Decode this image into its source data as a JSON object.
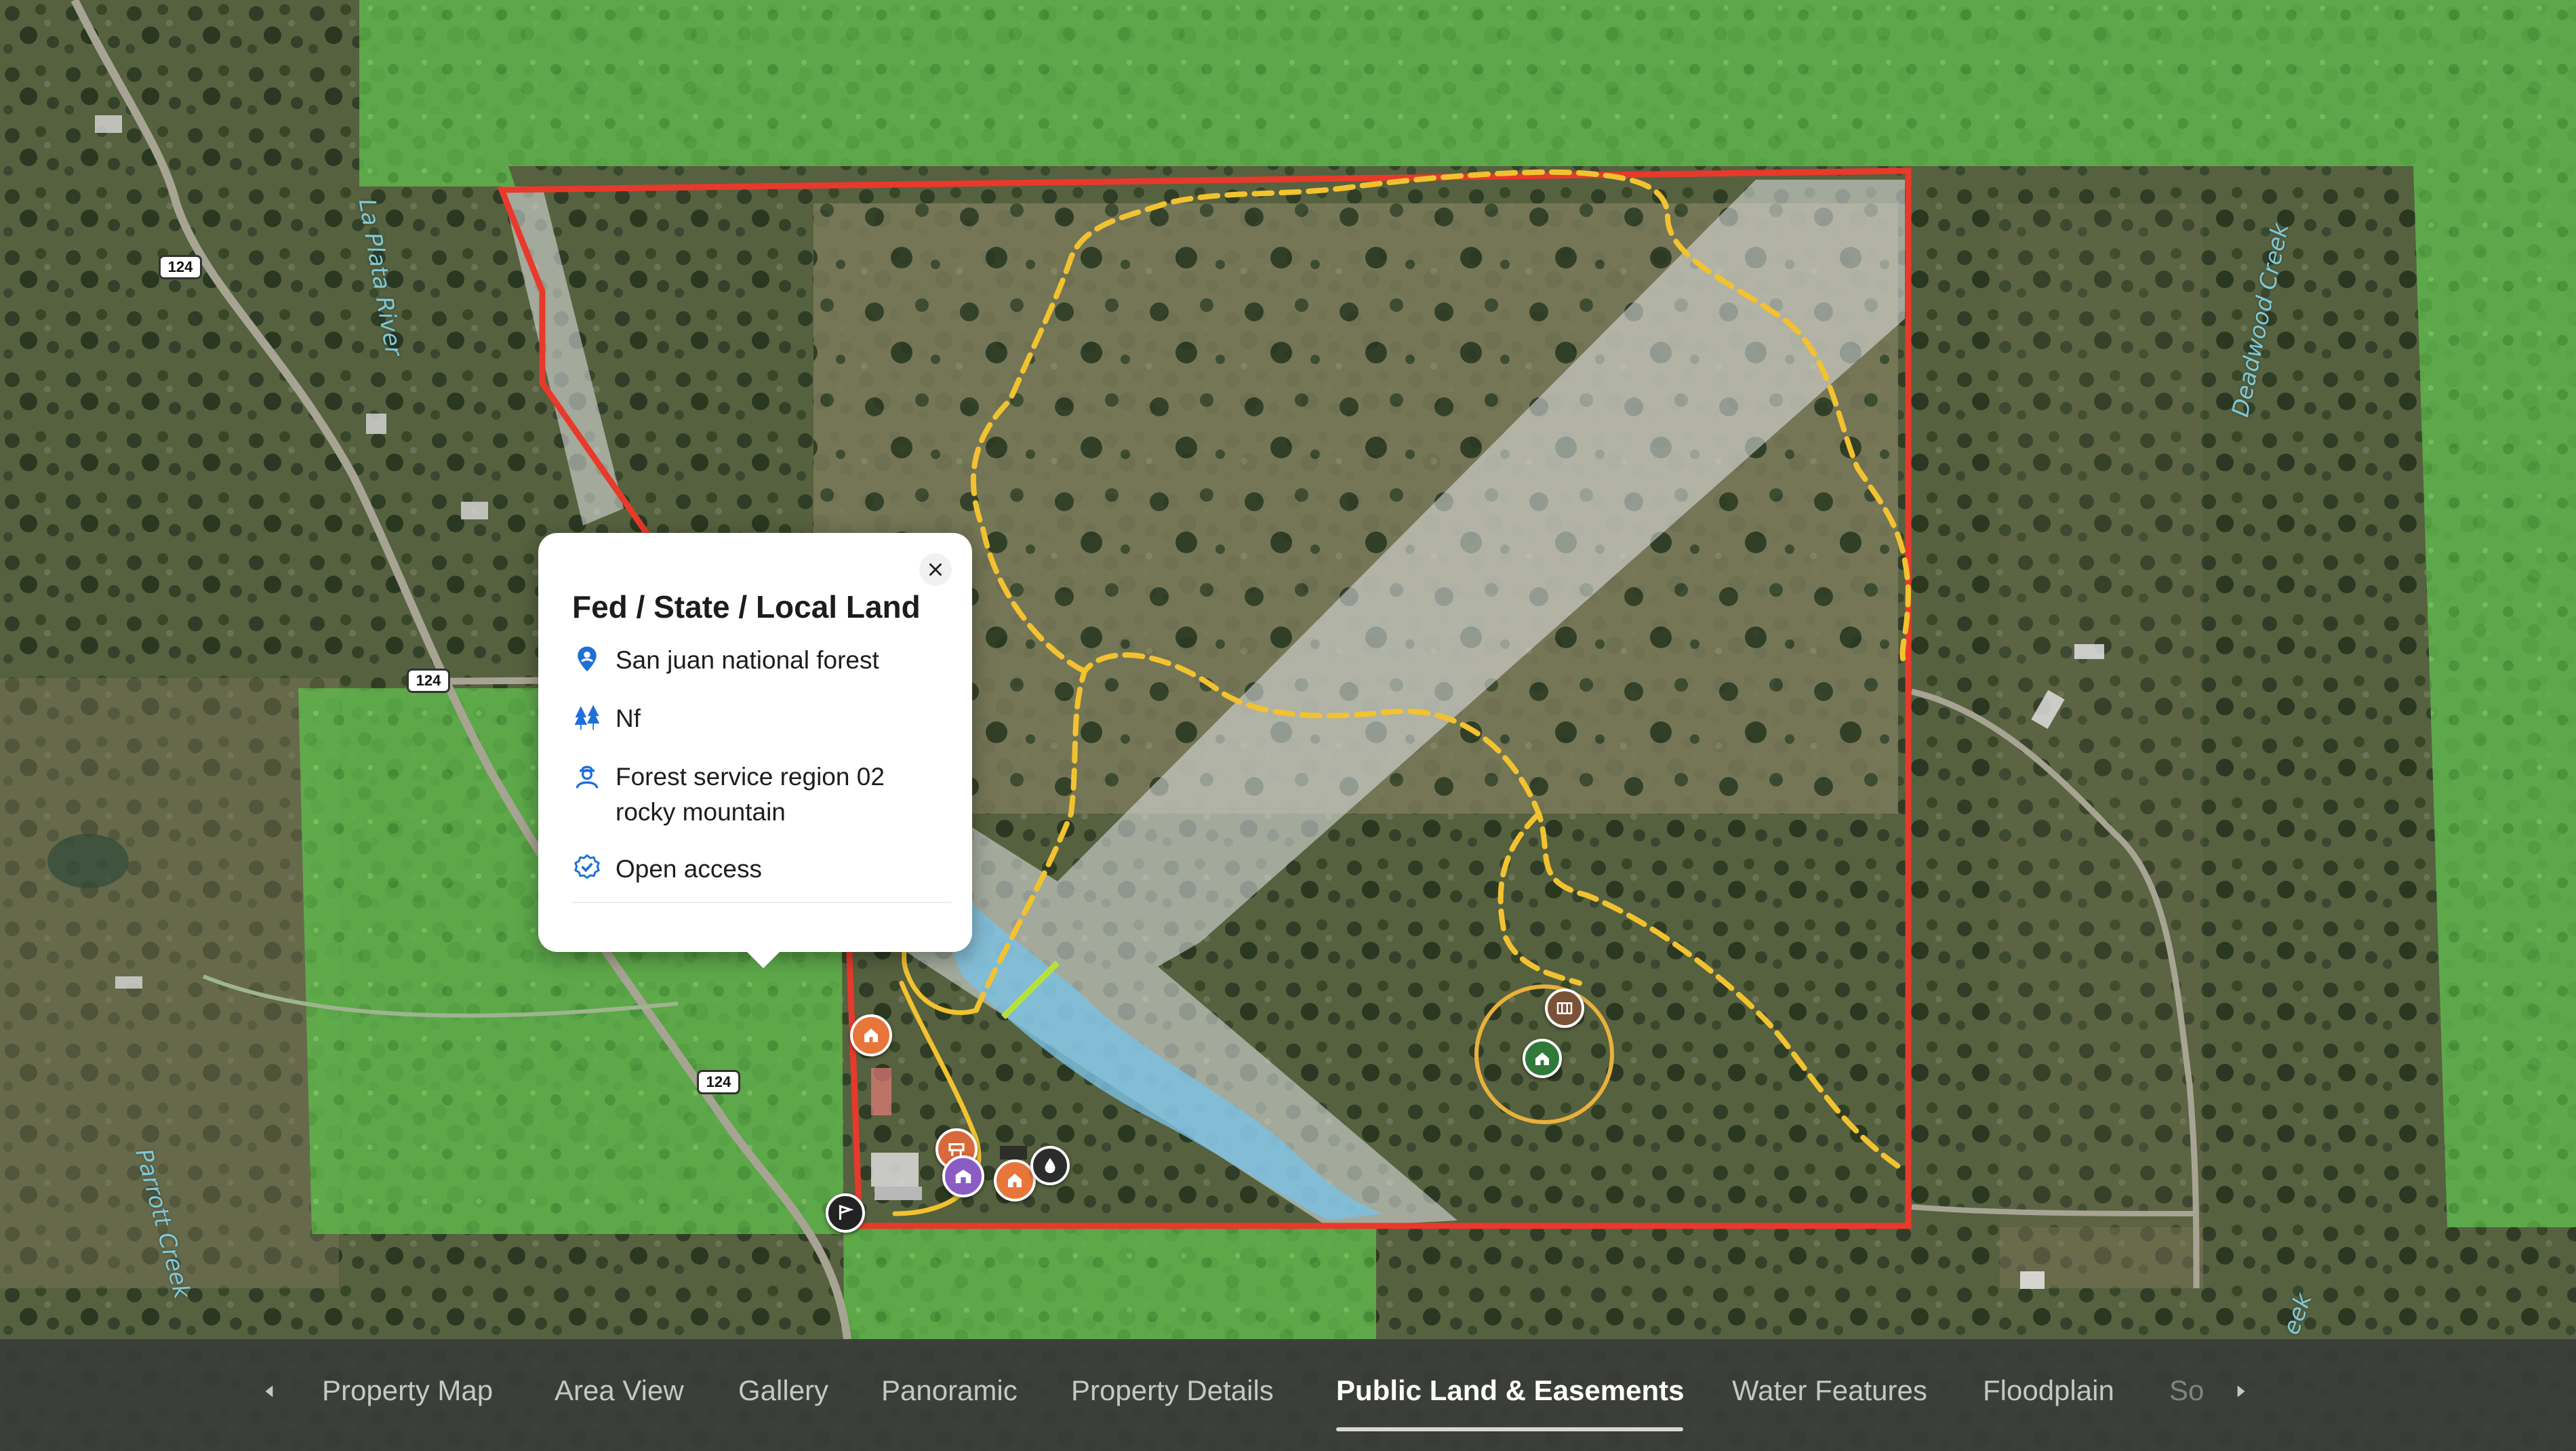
{
  "popup": {
    "title": "Fed / State / Local Land",
    "rows": [
      {
        "icon": "location-person-icon",
        "text": "San juan national forest"
      },
      {
        "icon": "trees-icon",
        "text": "Nf"
      },
      {
        "icon": "ranger-icon",
        "text": "Forest service region 02 rocky mountain"
      },
      {
        "icon": "check-badge-icon",
        "text": "Open access"
      }
    ]
  },
  "map_labels": {
    "la_plata_river": "La Plata River",
    "deadwood_creek": "Deadwood Creek",
    "parrott_creek": "Parrott Creek",
    "creek_bottom_right": "eek",
    "highway": "124"
  },
  "tabs": {
    "items": [
      {
        "label": "Property Map"
      },
      {
        "label": "Area View"
      },
      {
        "label": "Gallery"
      },
      {
        "label": "Panoramic"
      },
      {
        "label": "Property Details"
      },
      {
        "label": "Public Land & Easements"
      },
      {
        "label": "Water Features"
      },
      {
        "label": "Floodplain"
      },
      {
        "label": "So"
      }
    ],
    "active": "Public Land & Easements"
  },
  "colors": {
    "boundary": "#e8392b",
    "trail": "#f2c230",
    "public_land": "#6fcf5a",
    "easement": "#d9dde0",
    "water": "#6fb8e0"
  },
  "markers": [
    {
      "icon": "home-icon",
      "color": "#e8763a"
    },
    {
      "icon": "ranch-sign-icon",
      "color": "#d9683a"
    },
    {
      "icon": "barn-icon",
      "color": "#8b5cc4"
    },
    {
      "icon": "house-icon",
      "color": "#e8763a"
    },
    {
      "icon": "water-drop-icon",
      "color": "#2c2c2c"
    },
    {
      "icon": "gate-icon",
      "color": "#7a5238"
    },
    {
      "icon": "cabin-icon",
      "color": "#2f7a3a"
    },
    {
      "icon": "entrance-flag-icon",
      "color": "#222222"
    }
  ]
}
